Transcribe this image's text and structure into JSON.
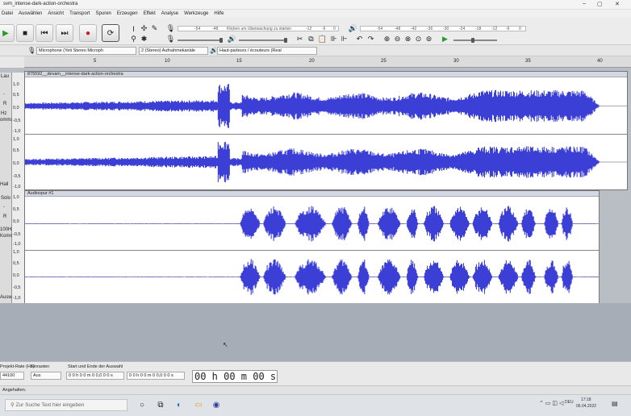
{
  "window": {
    "title": "svm_intense-dark-action-orchestra",
    "controls": [
      "–",
      "▢",
      "✕"
    ]
  },
  "menu": [
    "Datei",
    "Auswählen",
    "Ansicht",
    "Transport",
    "Spuren",
    "Erzeugen",
    "Effekt",
    "Analyse",
    "Werkzeuge",
    "Hilfe"
  ],
  "toolbar": {
    "record_meter_text": "Klicken um Überwachung zu starten",
    "record_meter_ticks": [
      "-54",
      "-48",
      "-12",
      "-6",
      "0"
    ],
    "play_meter_ticks": [
      "-54",
      "-48",
      "-42",
      "-36",
      "-30",
      "-24",
      "-18",
      "-12",
      "-6",
      "0"
    ]
  },
  "devices": {
    "input_device": "Microphone (Yeti Stereo Microph",
    "input_channels": "2 (Stereo) Aufnahmekanäle",
    "output_device": "Haut-parleurs / écouteurs (Real"
  },
  "ruler": {
    "ticks": [
      "5",
      "10",
      "15",
      "20",
      "25",
      "30",
      "35",
      "40"
    ]
  },
  "tracks": [
    {
      "clip_name": "875592__devam__intense-dark-action-orchestra",
      "scale": [
        "1,0",
        "0,5",
        "0,0",
        "-0,5",
        "-1,0",
        "1,0",
        "0,5",
        "0,0",
        "-0,5",
        "-1,0"
      ],
      "ctl_labels": [
        "Lau",
        "-",
        "R",
        "Hz",
        "omma",
        "Hall"
      ]
    },
    {
      "clip_name": "Audiospur #1",
      "scale": [
        "1,0",
        "0,5",
        "0,0",
        "-0,5",
        "-1,0",
        "1,0",
        "0,5",
        "0,0",
        "-0,5",
        "-1,0"
      ],
      "ctl_labels": [
        "Solo",
        "-",
        "R",
        "100Hz",
        "Komma",
        "Auswahl"
      ]
    }
  ],
  "selection": {
    "project_rate_label": "Projekt-Rate (Hz)",
    "project_rate_value": "44100",
    "snap_label": "Einrasten",
    "snap_value": "Aus",
    "range_label": "Start und Ende der Auswahl",
    "start_value": "0 0 h 0 0 m 0 0,0 0 0 s",
    "end_value": "0 0 h 0 0 m 0 0,0 0 0 s",
    "audio_position": "00 h 00 m 00 s"
  },
  "status": {
    "text": "Angehalten."
  },
  "taskbar": {
    "search_placeholder": "Zur Suche Text hier eingeben",
    "lang": "DEU",
    "time": "17:18",
    "date": "06.04.2022"
  },
  "colors": {
    "waveform": "#3b3fd6",
    "waveform_rms": "#6f72e8",
    "clip_bg": "#ffffff",
    "empty_bg": "#a7adb7"
  }
}
